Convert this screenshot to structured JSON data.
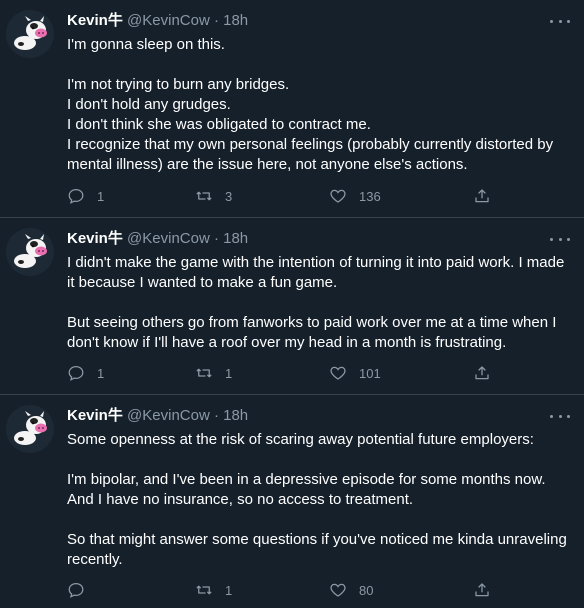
{
  "tweets": [
    {
      "display_name": "Kevin牛",
      "meta": "@KevinCow · 18h",
      "paragraphs": [
        [
          "I'm gonna sleep on this."
        ],
        [
          "I'm not trying to burn any bridges.",
          "I don't hold any grudges.",
          "I don't think she was obligated to contract me.",
          "I recognize that my own personal feelings (probably currently distorted by",
          "mental illness) are the issue here, not anyone else's actions."
        ]
      ],
      "replies": "1",
      "retweets": "3",
      "likes": "136"
    },
    {
      "display_name": "Kevin牛",
      "meta": "@KevinCow · 18h",
      "paragraphs": [
        [
          "I didn't make the game with the intention of turning it into paid work. I made",
          "it because I wanted to make a fun game."
        ],
        [
          "But seeing others go from fanworks to paid work over me at a time when I",
          "don't know if I'll have a roof over my head in a month is frustrating."
        ]
      ],
      "replies": "1",
      "retweets": "1",
      "likes": "101"
    },
    {
      "display_name": "Kevin牛",
      "meta": "@KevinCow · 18h",
      "paragraphs": [
        [
          "Some openness at the risk of scaring away potential future employers:"
        ],
        [
          "I'm bipolar, and I've been in a depressive episode for some months now.",
          "And I have no insurance, so no access to treatment."
        ],
        [
          "So that might answer some questions if you've noticed me kinda unraveling",
          "recently."
        ]
      ],
      "replies": "",
      "retweets": "1",
      "likes": "80"
    }
  ],
  "colors": {
    "background": "#15202b",
    "text": "#ffffff",
    "secondary": "#8b98a5",
    "divider": "#38444d"
  }
}
